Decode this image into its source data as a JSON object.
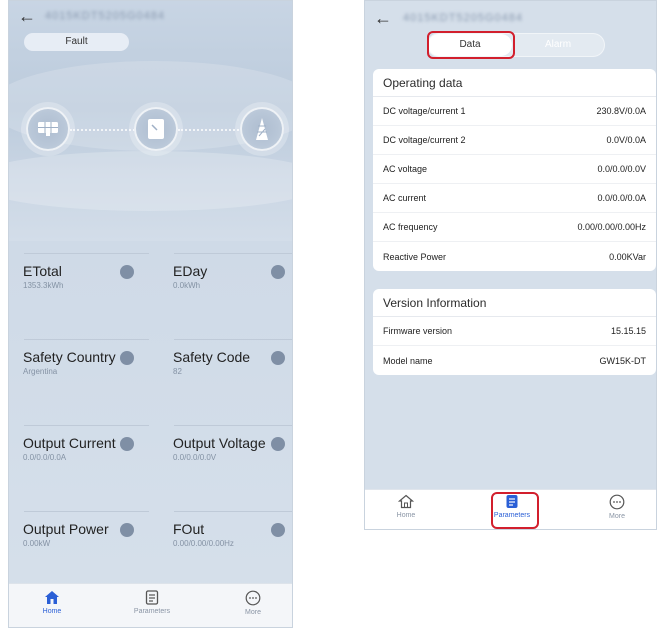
{
  "left": {
    "serial": "4015KDT5205G0484",
    "status": "Fault",
    "metrics": [
      {
        "title": "ETotal",
        "value": "1353.3kWh",
        "icon": "energy-total-icon"
      },
      {
        "title": "EDay",
        "value": "0.0kWh",
        "icon": "energy-day-icon"
      },
      {
        "title": "Safety Country",
        "value": "Argentina",
        "icon": "shield-check-icon"
      },
      {
        "title": "Safety Code",
        "value": "82",
        "icon": "code-icon"
      },
      {
        "title": "Output Current",
        "value": "0.0/0.0/0.0A",
        "icon": "current-out-icon"
      },
      {
        "title": "Output Voltage",
        "value": "0.0/0.0/0.0V",
        "icon": "voltage-out-icon"
      },
      {
        "title": "Output Power",
        "value": "0.00kW",
        "icon": "power-out-icon"
      },
      {
        "title": "FOut",
        "value": "0.00/0.00/0.00Hz",
        "icon": "frequency-out-icon"
      }
    ],
    "tabbar": {
      "home": "Home",
      "parameters": "Parameters",
      "more": "More"
    }
  },
  "right": {
    "serial": "4015KDT5205G0484",
    "tabs": {
      "data": "Data",
      "alarm": "Alarm"
    },
    "operating": {
      "heading": "Operating data",
      "rows": [
        {
          "label": "DC voltage/current 1",
          "value": "230.8V/0.0A"
        },
        {
          "label": "DC voltage/current 2",
          "value": "0.0V/0.0A"
        },
        {
          "label": "AC voltage",
          "value": "0.0/0.0/0.0V"
        },
        {
          "label": "AC current",
          "value": "0.0/0.0/0.0A"
        },
        {
          "label": "AC frequency",
          "value": "0.00/0.00/0.00Hz"
        },
        {
          "label": "Reactive Power",
          "value": "0.00KVar"
        }
      ]
    },
    "version": {
      "heading": "Version Information",
      "rows": [
        {
          "label": "Firmware version",
          "value": "15.15.15"
        },
        {
          "label": "Model name",
          "value": "GW15K-DT"
        }
      ]
    },
    "tabbar": {
      "home": "Home",
      "parameters": "Parameters",
      "more": "More"
    }
  },
  "colors": {
    "accent": "#2a5fd6",
    "highlight": "#d21f2d",
    "muted": "#7f8fa5"
  }
}
